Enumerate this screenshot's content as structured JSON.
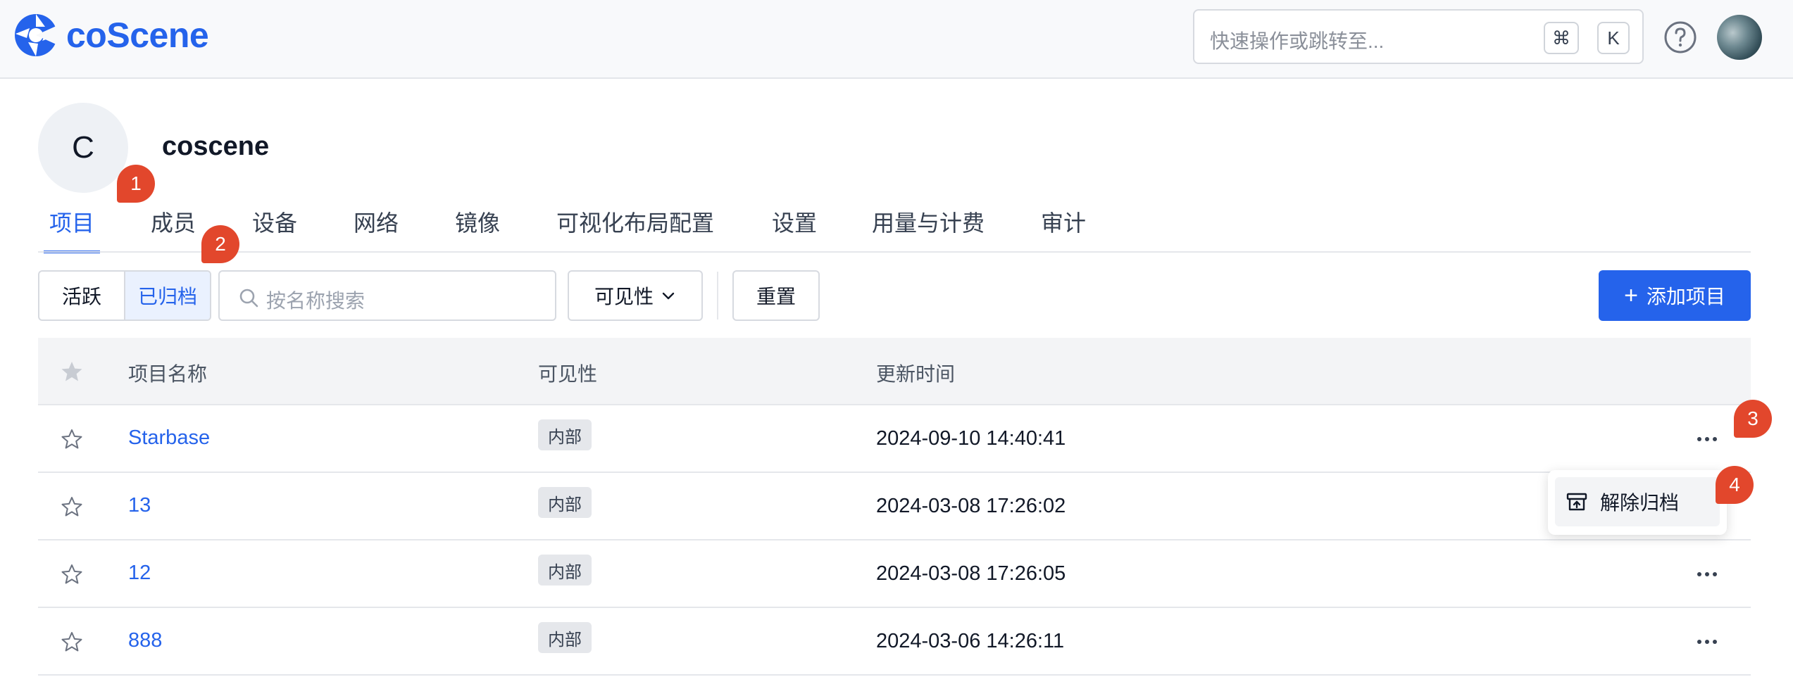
{
  "app": {
    "logo_text": "coScene",
    "brand_color": "#2563eb"
  },
  "topbar": {
    "quick_search_placeholder": "快速操作或跳转至...",
    "shortcut_keys": [
      "⌘",
      "K"
    ],
    "help_icon": "question-circle-icon",
    "avatar": "user-avatar"
  },
  "org": {
    "avatar_letter": "C",
    "name": "coscene"
  },
  "tabs": [
    {
      "label": "项目",
      "active": true
    },
    {
      "label": "成员",
      "active": false
    },
    {
      "label": "设备",
      "active": false
    },
    {
      "label": "网络",
      "active": false
    },
    {
      "label": "镜像",
      "active": false
    },
    {
      "label": "可视化布局配置",
      "active": false
    },
    {
      "label": "设置",
      "active": false
    },
    {
      "label": "用量与计费",
      "active": false
    },
    {
      "label": "审计",
      "active": false
    }
  ],
  "markers": [
    "1",
    "2",
    "3",
    "4"
  ],
  "toolbar": {
    "segment_active": "活跃",
    "segment_archived": "已归档",
    "search_placeholder": "按名称搜索",
    "visibility_label": "可见性",
    "reset_label": "重置",
    "add_label": "添加项目"
  },
  "table": {
    "columns": [
      "项目名称",
      "可见性",
      "更新时间"
    ],
    "rows": [
      {
        "name": "Starbase",
        "visibility": "内部",
        "updated": "2024-09-10 14:40:41"
      },
      {
        "name": "13",
        "visibility": "内部",
        "updated": "2024-03-08 17:26:02"
      },
      {
        "name": "12",
        "visibility": "内部",
        "updated": "2024-03-08 17:26:05"
      },
      {
        "name": "888",
        "visibility": "内部",
        "updated": "2024-03-06 14:26:11"
      }
    ]
  },
  "row_menu": {
    "unarchive_label": "解除归档",
    "icon": "unarchive-box-icon"
  }
}
